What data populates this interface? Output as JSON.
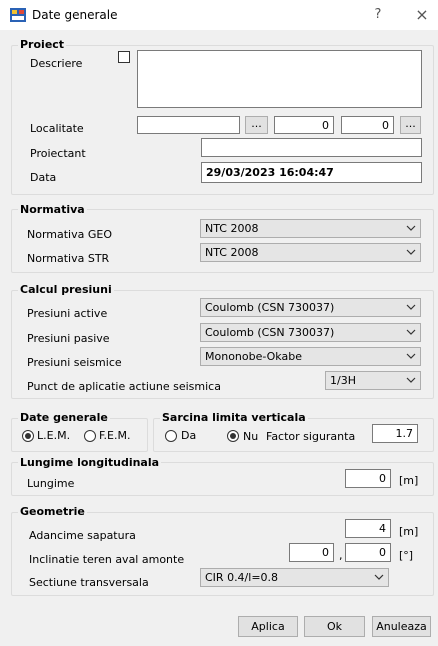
{
  "window": {
    "title": "Date generale",
    "help": "?",
    "close": "×"
  },
  "proiect": {
    "legend": "Proiect",
    "descriere_label": "Descriere",
    "descriere_value": "",
    "localitate_label": "Localitate",
    "localitate_value": "",
    "browse": "...",
    "coord1": "0",
    "coord2": "0",
    "browse2": "...",
    "proiectant_label": "Proiectant",
    "proiectant_value": "",
    "data_label": "Data",
    "data_value": "29/03/2023 16:04:47"
  },
  "normativa": {
    "legend": "Normativa",
    "geo_label": "Normativa GEO",
    "geo_value": "NTC 2008",
    "str_label": "Normativa STR",
    "str_value": "NTC 2008"
  },
  "calcul": {
    "legend": "Calcul presiuni",
    "active_label": "Presiuni active",
    "active_value": "Coulomb (CSN 730037)",
    "pasive_label": "Presiuni pasive",
    "pasive_value": "Coulomb (CSN 730037)",
    "seismice_label": "Presiuni seismice",
    "seismice_value": "Mononobe-Okabe",
    "punct_label": "Punct de aplicatie actiune seismica",
    "punct_value": "1/3H"
  },
  "date_generale": {
    "legend": "Date generale",
    "lem": "L.E.M.",
    "fem": "F.E.M.",
    "selected": "L.E.M."
  },
  "sarcina": {
    "legend": "Sarcina limita verticala",
    "da": "Da",
    "nu": "Nu",
    "selected": "Nu",
    "factor_label": "Factor siguranta",
    "factor_value": "1.7"
  },
  "lungime": {
    "legend": "Lungime longitudinala",
    "label": "Lungime",
    "value": "0",
    "unit": "[m]"
  },
  "geometrie": {
    "legend": "Geometrie",
    "adancime_label": "Adancime sapatura",
    "adancime_value": "4",
    "adancime_unit": "[m]",
    "inclinatie_label": "Inclinatie teren aval amonte",
    "inclinatie_aval": "0",
    "inclinatie_sep": ",",
    "inclinatie_amonte": "0",
    "inclinatie_unit": "[°]",
    "sectiune_label": "Sectiune transversala",
    "sectiune_value": "CIR 0.4/l=0.8"
  },
  "buttons": {
    "aplica": "Aplica",
    "ok": "Ok",
    "anuleaza": "Anuleaza"
  }
}
